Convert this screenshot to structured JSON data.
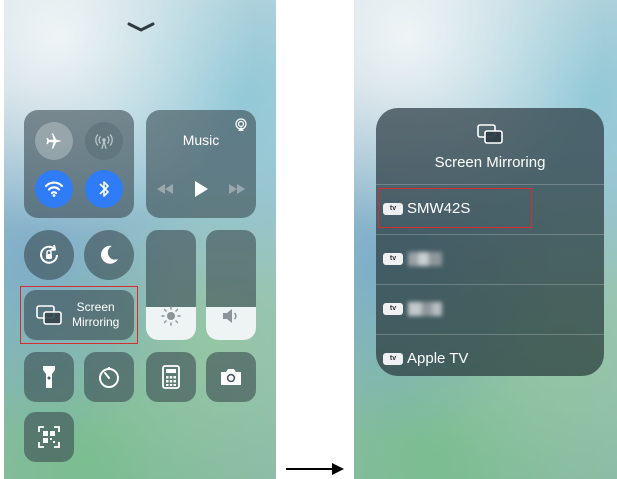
{
  "control_center": {
    "music": {
      "title": "Music"
    },
    "screen_mirroring": {
      "line1": "Screen",
      "line2": "Mirroring"
    },
    "brightness_level_pct": 30,
    "volume_level_pct": 30
  },
  "mirroring_panel": {
    "title": "Screen Mirroring",
    "devices": [
      {
        "badge": "tv",
        "name": "SMW42S"
      },
      {
        "badge": "tv",
        "name": ""
      },
      {
        "badge": "tv",
        "name": ""
      },
      {
        "badge": "tv",
        "name": "Apple TV"
      }
    ]
  },
  "colors": {
    "accent_blue": "#2f7cf6",
    "highlight_red": "#d42e2e"
  }
}
